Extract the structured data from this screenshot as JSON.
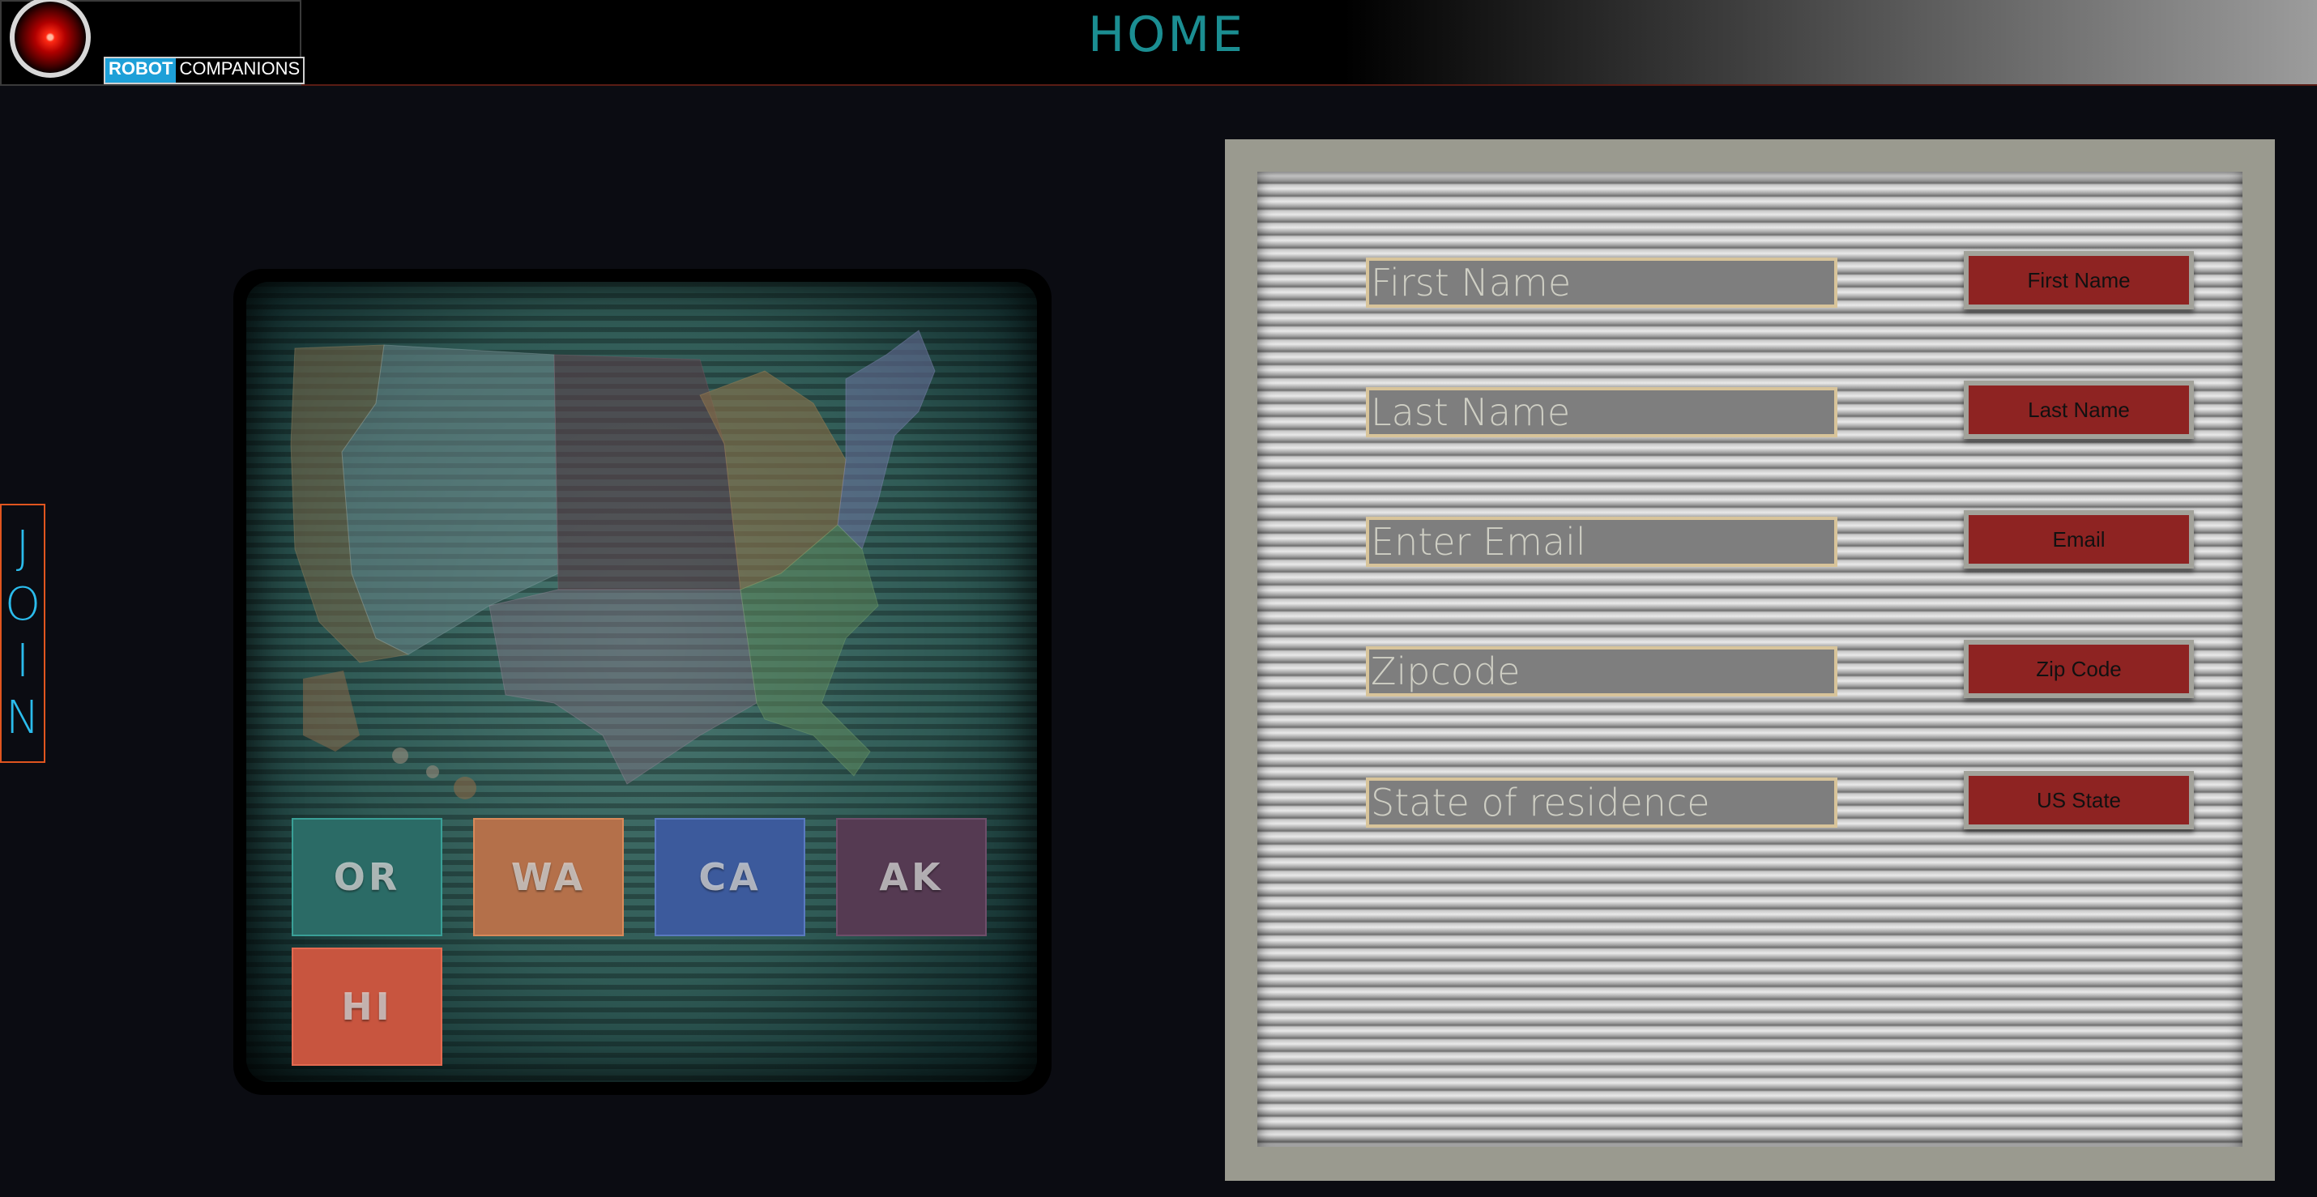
{
  "header": {
    "title": "HOME",
    "brand_part1": "ROBOT",
    "brand_part2": "COMPANIONS"
  },
  "join_tab": {
    "letters": [
      "J",
      "O",
      "I",
      "N"
    ],
    "accent_color": "#e0551f",
    "text_color": "#2bbcec"
  },
  "map": {
    "state_buttons": [
      {
        "label": "OR",
        "color": "#2b6b66"
      },
      {
        "label": "WA",
        "color": "#b4704a"
      },
      {
        "label": "CA",
        "color": "#3c5a9c"
      },
      {
        "label": "AK",
        "color": "#553a52"
      },
      {
        "label": "HI",
        "color": "#c8553f"
      }
    ]
  },
  "form": {
    "fields": [
      {
        "placeholder": "First Name",
        "button": "First Name"
      },
      {
        "placeholder": "Last Name",
        "button": "Last Name"
      },
      {
        "placeholder": "Enter Email",
        "button": "Email"
      },
      {
        "placeholder": "Zipcode",
        "button": "Zip Code"
      },
      {
        "placeholder": "State of residence",
        "button": "US State"
      }
    ],
    "button_color": "#8e2322",
    "field_border_color": "#d8c49a"
  },
  "colors": {
    "background": "#0b0c12",
    "title": "#1b8e92"
  }
}
